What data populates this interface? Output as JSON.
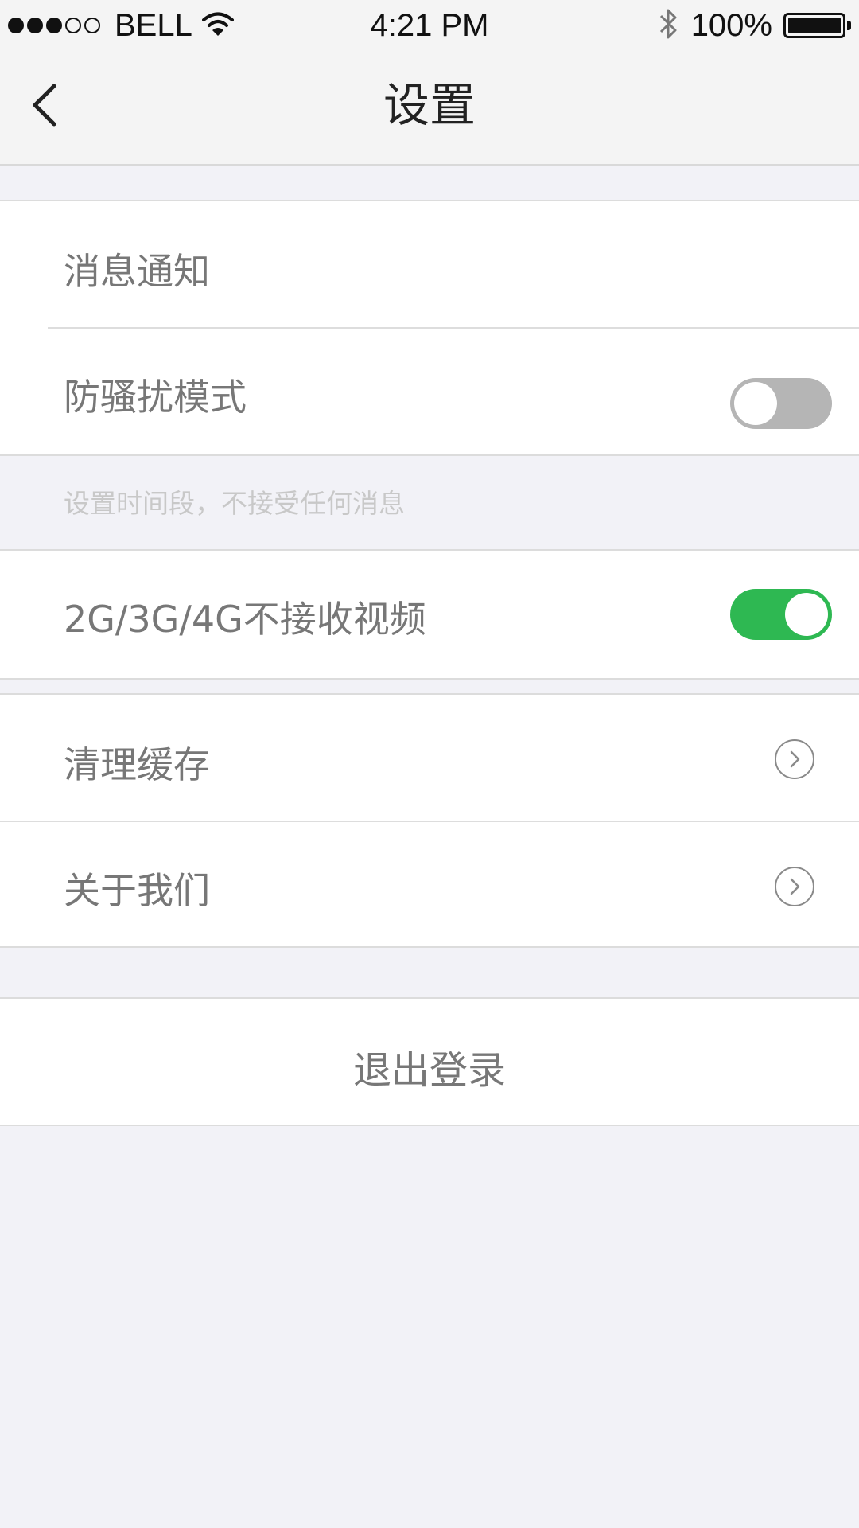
{
  "status_bar": {
    "signal": {
      "filled": 3,
      "total": 5
    },
    "carrier": "BELL",
    "time": "4:21 PM",
    "battery_percent": "100%",
    "icons": [
      "wifi-icon",
      "bluetooth-icon",
      "battery-icon"
    ]
  },
  "nav": {
    "title": "设置",
    "back_icon": "chevron-left-icon"
  },
  "settings": {
    "notifications_label": "消息通知",
    "dnd_label": "防骚扰模式",
    "dnd_enabled": false,
    "dnd_hint": "设置时间段，不接受任何消息",
    "cellular_video_label": "2G/3G/4G不接收视频",
    "cellular_video_enabled": true,
    "clear_cache_label": "清理缓存",
    "about_label": "关于我们",
    "logout_label": "退出登录"
  },
  "colors": {
    "toggle_on": "#2eb852",
    "toggle_off": "#b5b5b5",
    "background": "#f2f2f7"
  }
}
